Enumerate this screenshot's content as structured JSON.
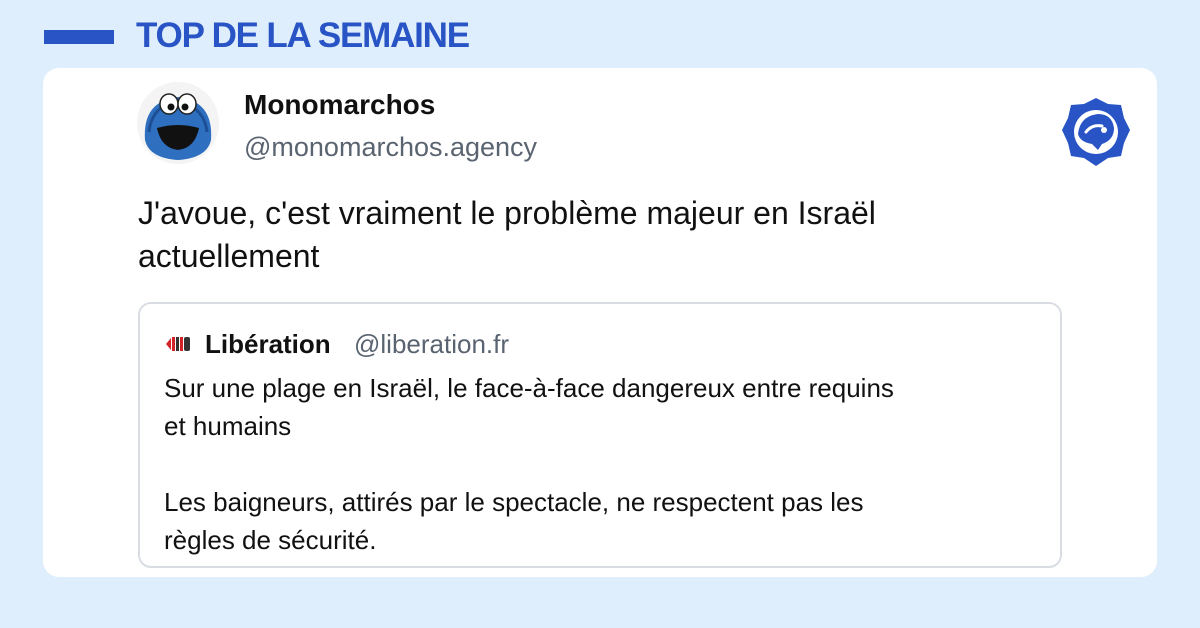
{
  "header": {
    "title": "TOP DE LA SEMAINE",
    "accent_color": "#2854c5"
  },
  "post": {
    "author_name": "Monomarchos",
    "author_handle": "@monomarchos.agency",
    "avatar_icon": "cookie-monster-avatar",
    "platform_icon": "bluesky-butterfly-logo",
    "text": "J'avoue, c'est vraiment le problème majeur en Israël\nactuellement",
    "quote": {
      "logo_icon": "liberation-logo-icon",
      "author_name": "Libération",
      "author_handle": "@liberation.fr",
      "text": "Sur une plage en Israël, le face-à-face dangereux entre requins\net humains\n\nLes baigneurs, attirés par le spectacle, ne respectent pas les\nrègles de sécurité."
    }
  }
}
